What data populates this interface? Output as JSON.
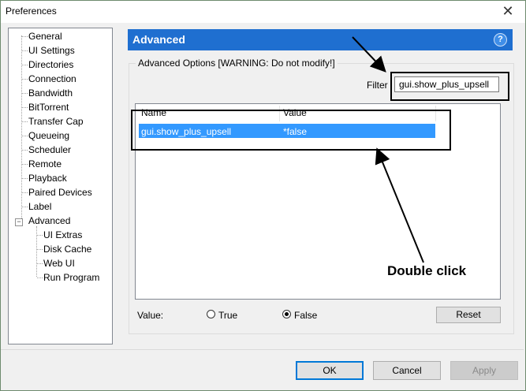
{
  "window": {
    "title": "Preferences",
    "close_glyph": "✕"
  },
  "sidebar": {
    "items": [
      {
        "label": "General"
      },
      {
        "label": "UI Settings"
      },
      {
        "label": "Directories"
      },
      {
        "label": "Connection"
      },
      {
        "label": "Bandwidth"
      },
      {
        "label": "BitTorrent"
      },
      {
        "label": "Transfer Cap"
      },
      {
        "label": "Queueing"
      },
      {
        "label": "Scheduler"
      },
      {
        "label": "Remote"
      },
      {
        "label": "Playback"
      },
      {
        "label": "Paired Devices"
      },
      {
        "label": "Label"
      },
      {
        "label": "Advanced",
        "expanded": true,
        "expander_glyph": "−"
      },
      {
        "label": "UI Extras"
      },
      {
        "label": "Disk Cache"
      },
      {
        "label": "Web UI"
      },
      {
        "label": "Run Program"
      }
    ]
  },
  "panel": {
    "title": "Advanced",
    "help_glyph": "?",
    "group_label": "Advanced Options [WARNING: Do not modify!]",
    "filter_label": "Filter",
    "filter_value": "gui.show_plus_upsell"
  },
  "table": {
    "columns": [
      "Name",
      "Value"
    ],
    "rows": [
      {
        "name": "gui.show_plus_upsell",
        "value": "*false",
        "selected": true
      }
    ]
  },
  "annotation": {
    "text": "Double click"
  },
  "value_editor": {
    "label": "Value:",
    "options": [
      {
        "label": "True",
        "checked": false
      },
      {
        "label": "False",
        "checked": true
      }
    ],
    "reset_label": "Reset"
  },
  "footer": {
    "ok_label": "OK",
    "cancel_label": "Cancel",
    "apply_label": "Apply",
    "apply_enabled": false
  },
  "colors": {
    "header_bg": "#1f6fd0",
    "selection": "#3399ff",
    "annotation": "#000000"
  }
}
